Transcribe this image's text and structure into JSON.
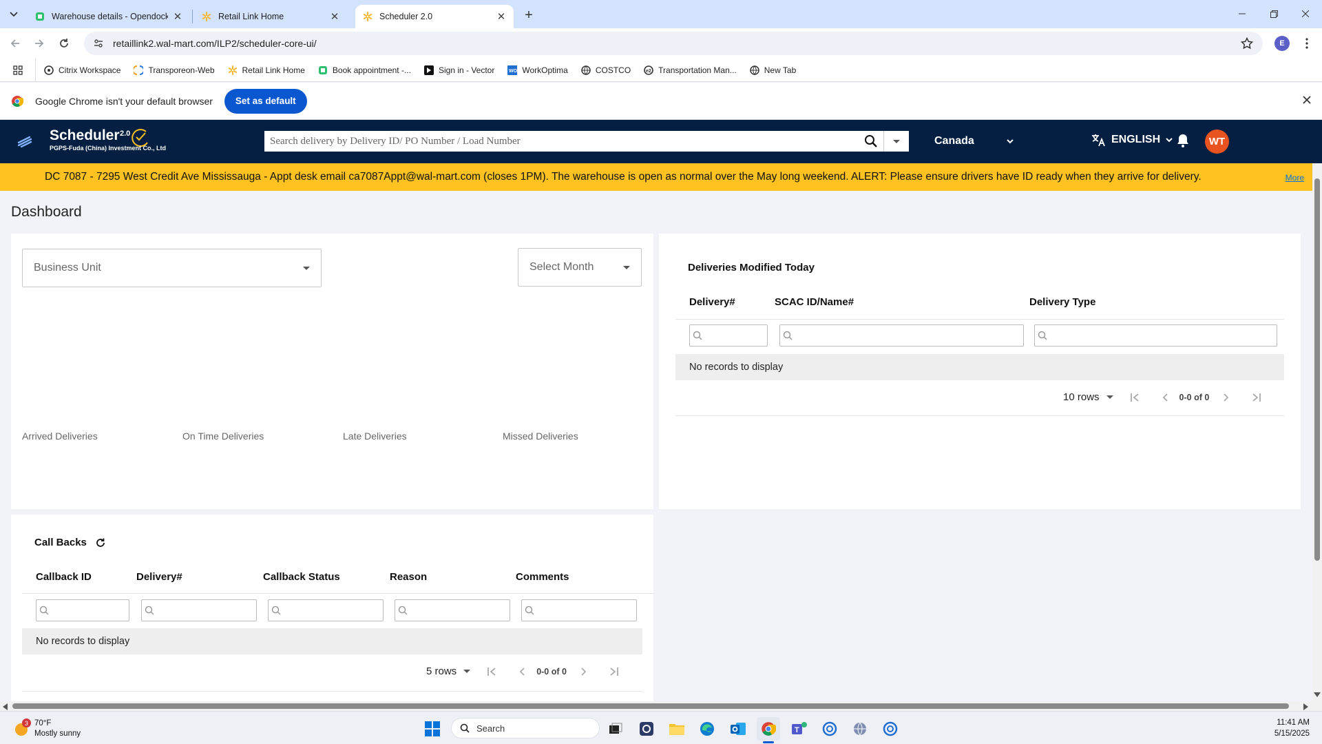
{
  "browser": {
    "tabs": [
      {
        "title": "Warehouse details - Opendock",
        "active": false
      },
      {
        "title": "Retail Link Home",
        "active": false
      },
      {
        "title": "Scheduler 2.0",
        "active": true
      }
    ],
    "url": "retaillink2.wal-mart.com/ILP2/scheduler-core-ui/",
    "profile_initial": "E",
    "bookmarks": [
      "Citrix Workspace",
      "Transporeon-Web",
      "Retail Link Home",
      "Book appointment -...",
      "Sign in - Vector",
      "WorkOptima",
      "COSTCO",
      "Transportation Man...",
      "New Tab"
    ],
    "default_bar": {
      "message": "Google Chrome isn't your default browser",
      "button": "Set as default"
    }
  },
  "app": {
    "logo_title": "Scheduler",
    "logo_version": "2.0",
    "logo_subtitle": "PGPS-Fuda (China) Investment Co., Ltd",
    "search_placeholder": "Search delivery by Delivery ID/ PO Number / Load Number",
    "region": "Canada",
    "language": "ENGLISH",
    "avatar": "WT",
    "alert": "DC 7087 - 7295 West Credit Ave Mississauga - Appt desk email ca7087Appt@wal-mart.com (closes 1PM). The warehouse is open as normal over the May long weekend. ALERT: Please ensure drivers have ID ready when they arrive for delivery.",
    "alert_more": "More"
  },
  "dashboard": {
    "title": "Dashboard",
    "business_unit": "Business Unit",
    "select_month": "Select Month",
    "stats": [
      "Arrived Deliveries",
      "On Time Deliveries",
      "Late Deliveries",
      "Missed Deliveries"
    ],
    "modified": {
      "title": "Deliveries Modified Today",
      "columns": [
        "Delivery#",
        "SCAC ID/Name#",
        "Delivery Type"
      ],
      "empty": "No records to display",
      "rows_label": "10 rows",
      "range": "0-0 of 0"
    },
    "callbacks": {
      "title": "Call Backs",
      "columns": [
        "Callback ID",
        "Delivery#",
        "Callback Status",
        "Reason",
        "Comments"
      ],
      "empty": "No records to display",
      "rows_label": "5 rows",
      "range": "0-0 of 0"
    }
  },
  "taskbar": {
    "weather_temp": "70°F",
    "weather_desc": "Mostly sunny",
    "weather_badge": "3",
    "search": "Search",
    "time": "11:41 AM",
    "date": "5/15/2025"
  },
  "colors": {
    "brand_navy": "#041f41",
    "alert_yellow": "#ffc220",
    "accent_blue": "#0b57d0",
    "avatar_orange": "#e8531f"
  }
}
